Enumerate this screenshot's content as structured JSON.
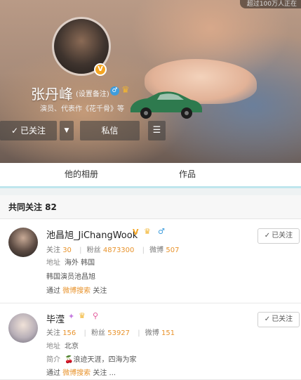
{
  "cover": {
    "top_badge": "超过100万人正在"
  },
  "profile": {
    "name": "张丹峰",
    "remark": "(设置备注)",
    "description": "演员、代表作《花千骨》等",
    "verified_badge": "V",
    "gender_symbol": "♂",
    "crown_symbol": "♛"
  },
  "actions": {
    "follow_label": "已关注",
    "more_symbol": "▼",
    "message_label": "私信",
    "menu_symbol": "☰"
  },
  "tabs": [
    {
      "label": "他的相册"
    },
    {
      "label": "作品"
    }
  ],
  "section": {
    "title": "共同关注 82"
  },
  "users": [
    {
      "name": "池昌旭_JiChangWook",
      "badges": [
        "V",
        "♛",
        "♂"
      ],
      "stats": {
        "following_label": "关注",
        "following": "30",
        "fans_label": "粉丝",
        "fans": "4873300",
        "posts_label": "微博",
        "posts": "507"
      },
      "address_label": "地址",
      "address": "海外 韩国",
      "intro": "韩国演员池昌旭",
      "via_prefix": "通过",
      "via_link": "微博搜索",
      "via_suffix": "关注",
      "follow_label": "已关注"
    },
    {
      "name": "毕滢",
      "badges": [
        "✦",
        "♛",
        "⚲"
      ],
      "stats": {
        "following_label": "关注",
        "following": "156",
        "fans_label": "粉丝",
        "fans": "53927",
        "posts_label": "微博",
        "posts": "151"
      },
      "address_label": "地址",
      "address": "北京",
      "intro_label": "简介",
      "intro": "浪迹天涯，四海为家",
      "intro_emoji": "🍒",
      "via_prefix": "通过",
      "via_link": "微博搜索",
      "via_suffix": "关注 ...",
      "follow_label": "已关注"
    }
  ],
  "colors": {
    "accent_orange": "#e8932c",
    "tab_underline": "#bfe6ed",
    "verified_orange": "#f5a623",
    "gender_blue": "#3e9ddd"
  }
}
